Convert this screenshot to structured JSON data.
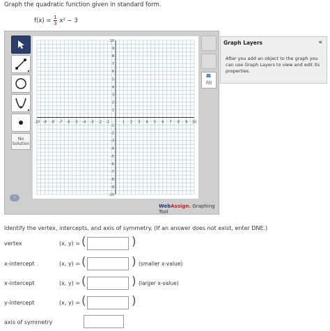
{
  "instruction": "Graph the quadratic function given in standard form.",
  "function": {
    "lhs": "f(x) =",
    "coef_num": "1",
    "coef_den": "3",
    "term": "x² − 3"
  },
  "tools": {
    "no_solution_line1": "No",
    "no_solution_line2": "Solution",
    "fill_label": "Fill"
  },
  "graph": {
    "x_ticks": [
      "-10",
      "-9",
      "-8",
      "-7",
      "-6",
      "-5",
      "-4",
      "-3",
      "-2",
      "-1",
      "1",
      "2",
      "3",
      "4",
      "5",
      "6",
      "7",
      "8",
      "9",
      "10"
    ],
    "y_ticks": [
      "10",
      "9",
      "8",
      "7",
      "6",
      "5",
      "4",
      "3",
      "2",
      "1",
      "-1",
      "-2",
      "-3",
      "-4",
      "-5",
      "-6",
      "-7",
      "-8",
      "-9",
      "-10"
    ],
    "xlim": [
      -10,
      10
    ],
    "ylim": [
      -10,
      10
    ],
    "grid": true
  },
  "branding": {
    "web": "Web",
    "assign": "Assign.",
    "rest": " Graphing Tool"
  },
  "layers": {
    "title": "Graph Layers",
    "collapse": "«",
    "description": "After you add an object to the graph you can use Graph Layers to view and edit its properties."
  },
  "questions": {
    "prompt": "Identify the vertex, intercepts, and axis of symmetry. (If an answer does not exist, enter DNE.)",
    "xy_label": "(x, y) =",
    "rows": [
      {
        "label": "vertex",
        "note": ""
      },
      {
        "label": "x-intercept",
        "note": "(smaller x-value)"
      },
      {
        "label": "x-intercept",
        "note": "(larger x-value)"
      },
      {
        "label": "y-intercept",
        "note": ""
      },
      {
        "label": "axis of symmetry",
        "note": ""
      }
    ]
  }
}
